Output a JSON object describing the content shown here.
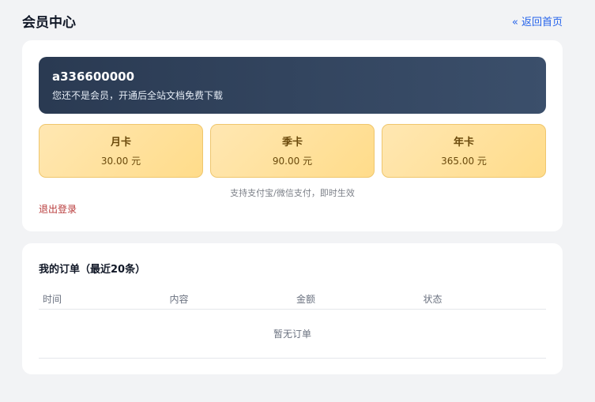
{
  "header": {
    "title": "会员中心",
    "back_link": "« 返回首页"
  },
  "member": {
    "username": "a336600000",
    "note": "您还不是会员，开通后全站文档免费下载",
    "plans": [
      {
        "name": "月卡",
        "price": "30.00 元"
      },
      {
        "name": "季卡",
        "price": "90.00 元"
      },
      {
        "name": "年卡",
        "price": "365.00 元"
      }
    ],
    "payment_note": "支持支付宝/微信支付，即时生效",
    "logout": "退出登录"
  },
  "orders": {
    "title": "我的订单（最近20条）",
    "columns": [
      "时间",
      "内容",
      "金额",
      "状态"
    ],
    "empty_text": "暂无订单"
  },
  "colors": {
    "accent_link": "#2563eb",
    "logout_link": "#b83b3b",
    "banner_start": "#2a3a52",
    "banner_end": "#3b4f6b",
    "plan_gold": "#ffdc8a"
  }
}
